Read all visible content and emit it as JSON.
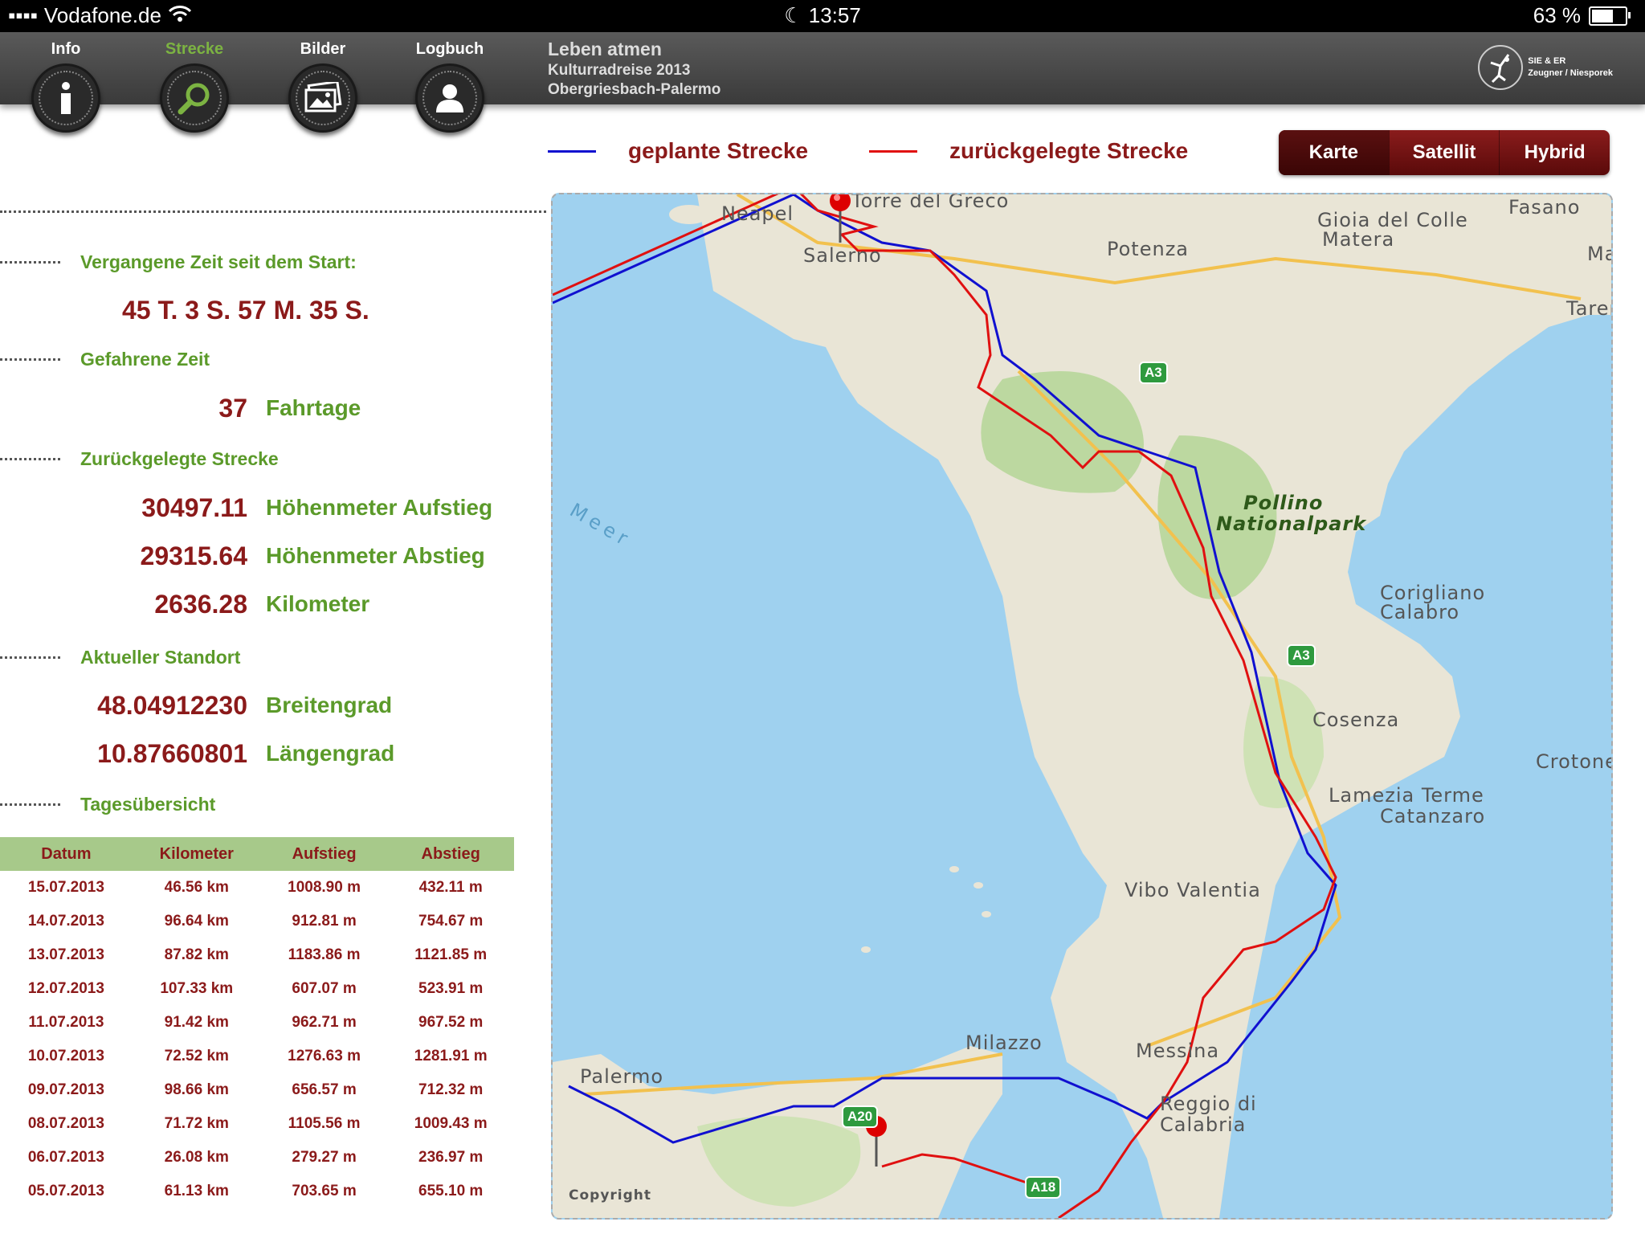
{
  "status": {
    "carrier": "Vodafone.de",
    "time": "13:57",
    "battery": "63 %"
  },
  "nav": {
    "tabs": [
      {
        "label": "Info"
      },
      {
        "label": "Strecke"
      },
      {
        "label": "Bilder"
      },
      {
        "label": "Logbuch"
      }
    ],
    "active": "Strecke"
  },
  "header": {
    "title": "Leben atmen",
    "subtitle1": "Kulturradreise 2013",
    "subtitle2": "Obergriesbach-Palermo",
    "logo_line1": "SIE & ER",
    "logo_line2": "Zeugner / Niesporek"
  },
  "legend": {
    "planned": "geplante Strecke",
    "travelled": "zurückgelegte Strecke",
    "planned_color": "#1010d0",
    "travelled_color": "#e01010"
  },
  "map_modes": [
    "Karte",
    "Satellit",
    "Hybrid"
  ],
  "stats": {
    "elapsed_label": "Vergangene Zeit seit dem Start:",
    "elapsed_value": "45 T. 3 S. 57 M. 35 S.",
    "driven_label": "Gefahrene Zeit",
    "days_value": "37",
    "days_unit": "Fahrtage",
    "distance_label": "Zurückgelegte Strecke",
    "ascent_value": "30497.11",
    "ascent_unit": "Höhenmeter Aufstieg",
    "descent_value": "29315.64",
    "descent_unit": "Höhenmeter Abstieg",
    "km_value": "2636.28",
    "km_unit": "Kilometer",
    "location_label": "Aktueller Standort",
    "lat_value": "48.04912230",
    "lat_unit": "Breitengrad",
    "lon_value": "10.87660801",
    "lon_unit": "Längengrad",
    "overview_label": "Tagesübersicht"
  },
  "table": {
    "headers": [
      "Datum",
      "Kilometer",
      "Aufstieg",
      "Abstieg"
    ],
    "rows": [
      [
        "15.07.2013",
        "46.56 km",
        "1008.90 m",
        "432.11 m"
      ],
      [
        "14.07.2013",
        "96.64 km",
        "912.81 m",
        "754.67 m"
      ],
      [
        "13.07.2013",
        "87.82 km",
        "1183.86 m",
        "1121.85 m"
      ],
      [
        "12.07.2013",
        "107.33 km",
        "607.07 m",
        "523.91 m"
      ],
      [
        "11.07.2013",
        "91.42 km",
        "962.71 m",
        "967.52 m"
      ],
      [
        "10.07.2013",
        "72.52 km",
        "1276.63 m",
        "1281.91 m"
      ],
      [
        "09.07.2013",
        "98.66 km",
        "656.57 m",
        "712.32 m"
      ],
      [
        "08.07.2013",
        "71.72 km",
        "1105.56 m",
        "1009.43 m"
      ],
      [
        "06.07.2013",
        "26.08 km",
        "279.27 m",
        "236.97 m"
      ],
      [
        "05.07.2013",
        "61.13 km",
        "703.65 m",
        "655.10 m"
      ]
    ]
  },
  "map": {
    "labels": [
      "Neapel",
      "Torre del Greco",
      "Salerno",
      "Potenza",
      "Gioia del Colle",
      "Matera",
      "Fasano",
      "Ma",
      "Taren",
      "Meer",
      "Pollino",
      "Nationalpark",
      "Corigliano",
      "Calabro",
      "Cosenza",
      "Lamezia Terme",
      "Catanzaro",
      "Crotone",
      "Vibo Valentia",
      "Milazzo",
      "Messina",
      "Palermo",
      "Reggio di",
      "Calabria",
      "Copyright"
    ],
    "shields": [
      "A3",
      "A3",
      "A20",
      "A18"
    ]
  }
}
